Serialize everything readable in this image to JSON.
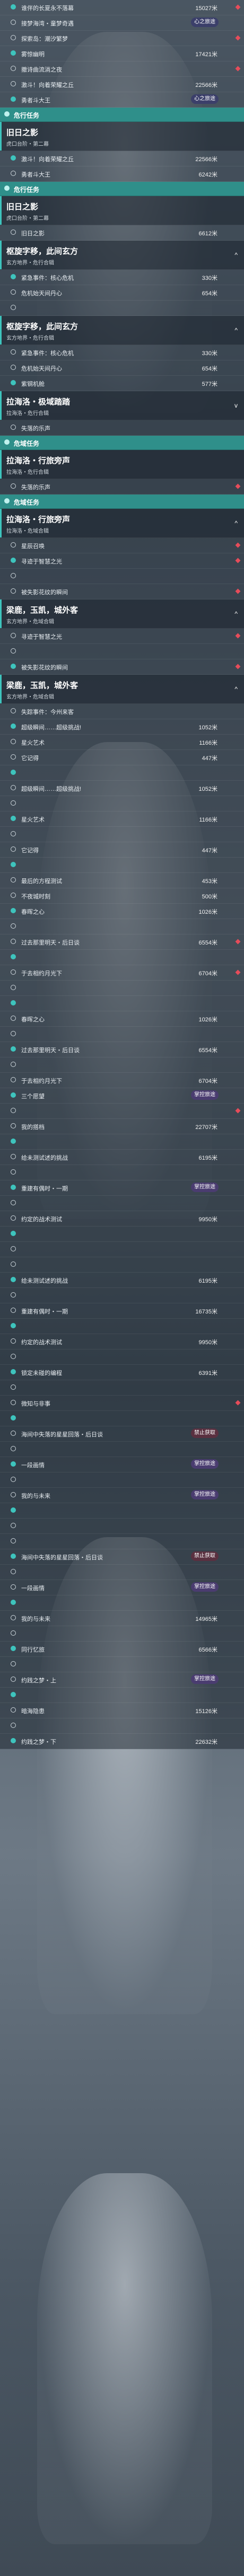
{
  "entries": [
    {
      "kind": "row",
      "name": "谁伴的长夏永不落幕",
      "dist": "15027米",
      "dia": true
    },
    {
      "kind": "row",
      "name": "接梦海湾・童梦奇遇",
      "dist": "16771米",
      "badge": "心之旅途"
    },
    {
      "kind": "row",
      "name": "探索岛：潮汐繁梦",
      "dist": "",
      "dia": true
    },
    {
      "kind": "row",
      "name": "雾惊幽明",
      "dist": "17421米"
    },
    {
      "kind": "row",
      "name": "撤诗曲流淌之夜",
      "dist": "",
      "dia": true
    },
    {
      "kind": "row",
      "name": "激斗！向着荣耀之丘",
      "dist": "22566米"
    },
    {
      "kind": "row",
      "name": "勇者斗大王",
      "dist": "6242米",
      "badge": "心之旅途"
    },
    {
      "kind": "sec",
      "name": "危行任务"
    },
    {
      "kind": "chap",
      "title": "旧日之影",
      "sub": "虎口台阶・第二幕"
    },
    {
      "kind": "row",
      "name": "激斗！向着荣耀之丘",
      "dist": "22566米"
    },
    {
      "kind": "row",
      "name": "勇者斗大王",
      "dist": "6242米"
    },
    {
      "kind": "sec",
      "name": "危行任务"
    },
    {
      "kind": "chap",
      "title": "旧日之影",
      "sub": "虎口台阶・第二幕"
    },
    {
      "kind": "row",
      "name": "旧日之影",
      "dist": "6612米"
    },
    {
      "kind": "chap",
      "title": "枢旋字移，此间玄方",
      "sub": "玄方地界・危行合辑",
      "cv": "^"
    },
    {
      "kind": "row",
      "name": "紧急事件：核心危机",
      "dist": "330米"
    },
    {
      "kind": "row",
      "name": "危机始天间丹心",
      "dist": "654米"
    },
    {
      "kind": "row",
      "name": "",
      "dist": ""
    },
    {
      "kind": "chap",
      "title": "枢旋字移，此间玄方",
      "sub": "玄方地界・危行合辑",
      "cv": "^"
    },
    {
      "kind": "row",
      "name": "紧急事件：核心危机",
      "dist": "330米"
    },
    {
      "kind": "row",
      "name": "危机始天间丹心",
      "dist": "654米"
    },
    {
      "kind": "row",
      "name": "紫钢机舱",
      "dist": "577米"
    },
    {
      "kind": "chap",
      "title": "拉海洛・极域踏踏",
      "sub": "拉海洛・危行合辑",
      "cv": "v"
    },
    {
      "kind": "row",
      "name": "失落的乐声",
      "dist": ""
    },
    {
      "kind": "sec",
      "name": "危域任务"
    },
    {
      "kind": "chap",
      "title": "拉海洛・行旅旁声",
      "sub": "拉海洛・危行合辑"
    },
    {
      "kind": "row",
      "name": "失落的乐声",
      "dist": "",
      "dia": true
    },
    {
      "kind": "sec",
      "name": "危域任务"
    },
    {
      "kind": "chap",
      "title": "拉海洛・行旅旁声",
      "sub": "拉海洛・危域合辑",
      "cv": "^"
    },
    {
      "kind": "row",
      "name": "星辰召唤",
      "dist": "",
      "dia": true
    },
    {
      "kind": "row",
      "name": "寻迹于智慧之光",
      "dist": "",
      "dia": true
    },
    {
      "kind": "row",
      "name": "",
      "dist": ""
    },
    {
      "kind": "row",
      "name": "被失影花纹的瞬间",
      "dist": "",
      "dia": true
    },
    {
      "kind": "chap",
      "title": "梁鹿，玉凯，城外客",
      "sub": "玄方地界・危域合辑",
      "cv": "^"
    },
    {
      "kind": "row",
      "name": "寻迹于智慧之光",
      "dist": "",
      "dia": true
    },
    {
      "kind": "row",
      "name": "",
      "dist": ""
    },
    {
      "kind": "row",
      "name": "被失影花纹的瞬间",
      "dist": "",
      "dia": true
    },
    {
      "kind": "chap",
      "title": "梁鹿，玉凯，城外客",
      "sub": "玄方地界・危域合辑",
      "cv": "^"
    },
    {
      "kind": "row",
      "name": "失踪事件：今州来客",
      "dist": ""
    },
    {
      "kind": "row",
      "name": "超级瞬间……超级挑战!",
      "dist": "1052米"
    },
    {
      "kind": "row",
      "name": "星火艺术",
      "dist": "1166米"
    },
    {
      "kind": "row",
      "name": "它记得",
      "dist": "447米"
    },
    {
      "kind": "row",
      "name": "",
      "dist": ""
    },
    {
      "kind": "row",
      "name": "超级瞬间……超级挑战!",
      "dist": "1052米"
    },
    {
      "kind": "row",
      "name": "",
      "dist": ""
    },
    {
      "kind": "row",
      "name": "星火艺术",
      "dist": "1166米"
    },
    {
      "kind": "row",
      "name": "",
      "dist": ""
    },
    {
      "kind": "row",
      "name": "它记得",
      "dist": "447米"
    },
    {
      "kind": "row",
      "name": "",
      "dist": ""
    },
    {
      "kind": "row",
      "name": "最后的方程测试",
      "dist": "453米"
    },
    {
      "kind": "row",
      "name": "不夜城时刻",
      "dist": "500米"
    },
    {
      "kind": "row",
      "name": "春晖之心",
      "dist": "1026米"
    },
    {
      "kind": "row",
      "name": "",
      "dist": ""
    },
    {
      "kind": "row",
      "name": "过去那里明天・后日谈",
      "dist": "6554米",
      "dia": true
    },
    {
      "kind": "row",
      "name": "",
      "dist": ""
    },
    {
      "kind": "row",
      "name": "于去相约月光下",
      "dist": "6704米",
      "dia": true
    },
    {
      "kind": "row",
      "name": "",
      "dist": ""
    },
    {
      "kind": "row",
      "name": "",
      "dist": ""
    },
    {
      "kind": "row",
      "name": "春晖之心",
      "dist": "1026米"
    },
    {
      "kind": "row",
      "name": "",
      "dist": ""
    },
    {
      "kind": "row",
      "name": "过去那里明天・后日谈",
      "dist": "6554米"
    },
    {
      "kind": "row",
      "name": "",
      "dist": ""
    },
    {
      "kind": "row",
      "name": "于去相约月光下",
      "dist": "6704米"
    },
    {
      "kind": "row",
      "name": "三个愿望",
      "dist": "22557米",
      "badge": "掌控旅途",
      "b2": "alt"
    },
    {
      "kind": "row",
      "name": "",
      "dist": "",
      "dia": true
    },
    {
      "kind": "row",
      "name": "我的搭档",
      "dist": "22707米"
    },
    {
      "kind": "row",
      "name": "",
      "dist": ""
    },
    {
      "kind": "row",
      "name": "给未测试述的挑战",
      "dist": "6195米"
    },
    {
      "kind": "row",
      "name": "",
      "dist": ""
    },
    {
      "kind": "row",
      "name": "重建有偶时・一期",
      "dist": "16735米",
      "badge": "掌控旅途",
      "b2": "alt"
    },
    {
      "kind": "row",
      "name": "",
      "dist": ""
    },
    {
      "kind": "row",
      "name": "约定的战术测试",
      "dist": "9950米"
    },
    {
      "kind": "row",
      "name": "",
      "dist": ""
    },
    {
      "kind": "row",
      "name": "",
      "dist": ""
    },
    {
      "kind": "row",
      "name": "",
      "dist": ""
    },
    {
      "kind": "row",
      "name": "给未测试述的挑战",
      "dist": "6195米"
    },
    {
      "kind": "row",
      "name": "",
      "dist": ""
    },
    {
      "kind": "row",
      "name": "重建有偶时・一期",
      "dist": "16735米"
    },
    {
      "kind": "row",
      "name": "",
      "dist": ""
    },
    {
      "kind": "row",
      "name": "约定的战术测试",
      "dist": "9950米"
    },
    {
      "kind": "row",
      "name": "",
      "dist": ""
    },
    {
      "kind": "row",
      "name": "锁定未碰的编程",
      "dist": "6391米"
    },
    {
      "kind": "row",
      "name": "",
      "dist": ""
    },
    {
      "kind": "row",
      "name": "微知与非事",
      "dist": "",
      "dia": true
    },
    {
      "kind": "row",
      "name": "",
      "dist": ""
    },
    {
      "kind": "row",
      "name": "海间中失落的星星回落・后日谈",
      "dist": "9925米",
      "badge": "禁止获取",
      "b2": "warn"
    },
    {
      "kind": "row",
      "name": "",
      "dist": ""
    },
    {
      "kind": "row",
      "name": "一段画情",
      "dist": "22559米",
      "badge": "掌控旅途",
      "b2": "alt"
    },
    {
      "kind": "row",
      "name": "",
      "dist": ""
    },
    {
      "kind": "row",
      "name": "我的与未来",
      "dist": "14965米",
      "badge": "掌控旅途",
      "b2": "alt"
    },
    {
      "kind": "row",
      "name": "",
      "dist": ""
    },
    {
      "kind": "row",
      "name": "",
      "dist": ""
    },
    {
      "kind": "row",
      "name": "",
      "dist": ""
    },
    {
      "kind": "row",
      "name": "海间中失落的星星回落・后日谈",
      "dist": "9925米",
      "badge": "禁止获取",
      "b2": "warn"
    },
    {
      "kind": "row",
      "name": "",
      "dist": ""
    },
    {
      "kind": "row",
      "name": "一段画情",
      "dist": "22559米",
      "badge": "掌控旅途",
      "b2": "alt"
    },
    {
      "kind": "row",
      "name": "",
      "dist": ""
    },
    {
      "kind": "row",
      "name": "我的与未来",
      "dist": "14965米"
    },
    {
      "kind": "row",
      "name": "",
      "dist": ""
    },
    {
      "kind": "row",
      "name": "同行忆旅",
      "dist": "6566米"
    },
    {
      "kind": "row",
      "name": "",
      "dist": ""
    },
    {
      "kind": "row",
      "name": "约践之梦・上",
      "dist": "22760米",
      "badge": "掌控旅途",
      "b2": "alt"
    },
    {
      "kind": "row",
      "name": "",
      "dist": ""
    },
    {
      "kind": "row",
      "name": "暗海隐患",
      "dist": "15126米"
    },
    {
      "kind": "row",
      "name": "",
      "dist": ""
    },
    {
      "kind": "row",
      "name": "约践之梦・下",
      "dist": "22632米"
    }
  ]
}
